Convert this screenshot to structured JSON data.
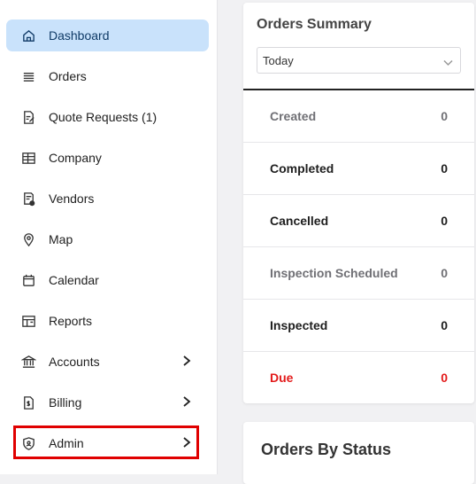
{
  "sidebar": {
    "items": [
      {
        "label": "Dashboard",
        "icon": "home-icon"
      },
      {
        "label": "Orders",
        "icon": "list-icon"
      },
      {
        "label": "Quote Requests (1)",
        "icon": "document-edit-icon"
      },
      {
        "label": "Company",
        "icon": "building-icon"
      },
      {
        "label": "Vendors",
        "icon": "vendor-doc-icon"
      },
      {
        "label": "Map",
        "icon": "map-pin-icon"
      },
      {
        "label": "Calendar",
        "icon": "calendar-icon"
      },
      {
        "label": "Reports",
        "icon": "reports-icon"
      },
      {
        "label": "Accounts",
        "icon": "bank-icon"
      },
      {
        "label": "Billing",
        "icon": "billing-icon"
      },
      {
        "label": "Admin",
        "icon": "shield-icon"
      }
    ]
  },
  "summary": {
    "title": "Orders Summary",
    "period": "Today",
    "rows": [
      {
        "label": "Created",
        "value": "0"
      },
      {
        "label": "Completed",
        "value": "0"
      },
      {
        "label": "Cancelled",
        "value": "0"
      },
      {
        "label": "Inspection Scheduled",
        "value": "0"
      },
      {
        "label": "Inspected",
        "value": "0"
      },
      {
        "label": "Due",
        "value": "0"
      }
    ]
  },
  "status": {
    "title": "Orders By Status"
  },
  "colors": {
    "active_bg": "#c9e2fb",
    "due": "#e31b1b",
    "highlight": "#e00000"
  }
}
